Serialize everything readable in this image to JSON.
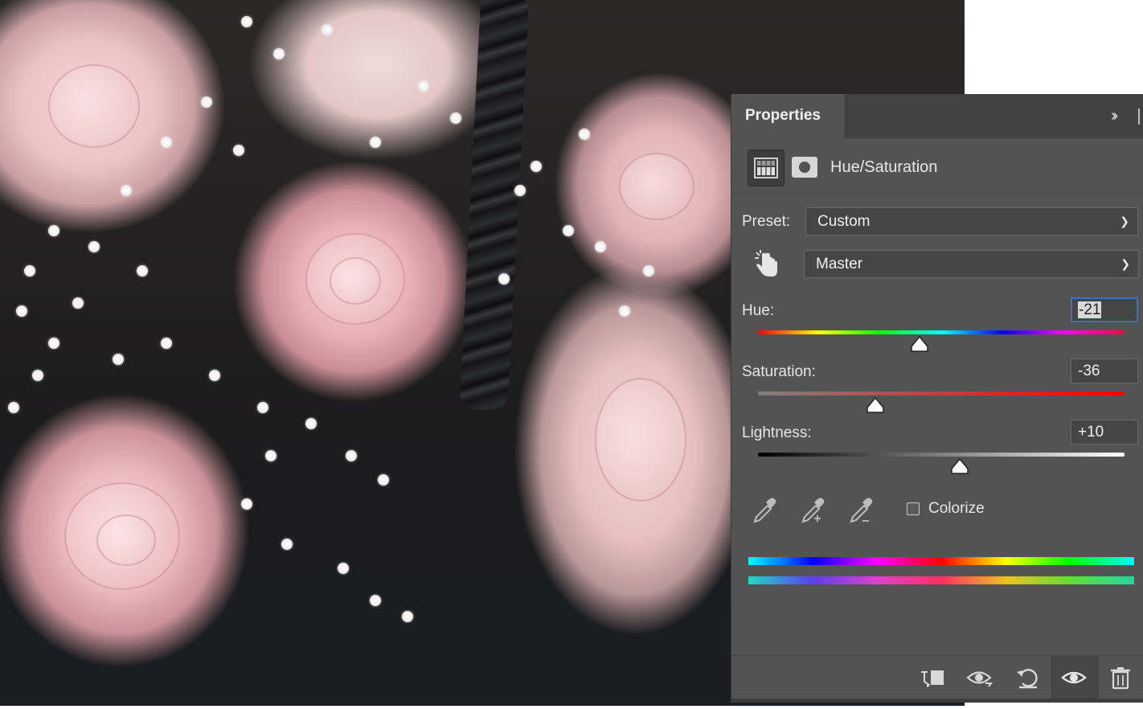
{
  "panel": {
    "tab_title": "Properties",
    "collapse_icon": "double-chevron-right-icon",
    "adjustment_name": "Hue/Saturation",
    "adjustment_icon": "hue-saturation-adjustment-icon",
    "mask_icon": "layer-mask-icon"
  },
  "preset": {
    "label": "Preset:",
    "value": "Custom"
  },
  "channel": {
    "value": "Master",
    "tool_icon": "targeted-adjustment-hand-icon"
  },
  "hue": {
    "label": "Hue:",
    "value": "-21",
    "slider_value": -21,
    "range": [
      -180,
      180
    ]
  },
  "saturation": {
    "label": "Saturation:",
    "value": "-36",
    "slider_value": -36,
    "range": [
      -100,
      100
    ]
  },
  "lightness": {
    "label": "Lightness:",
    "value": "+10",
    "slider_value": 10,
    "range": [
      -100,
      100
    ]
  },
  "eyedroppers": [
    "eyedropper-icon",
    "eyedropper-add-icon",
    "eyedropper-subtract-icon"
  ],
  "colorize": {
    "label": "Colorize",
    "checked": false
  },
  "footer_icons": [
    "clip-to-layer-icon",
    "view-previous-state-icon",
    "reset-icon",
    "visibility-eye-icon",
    "trash-icon"
  ]
}
